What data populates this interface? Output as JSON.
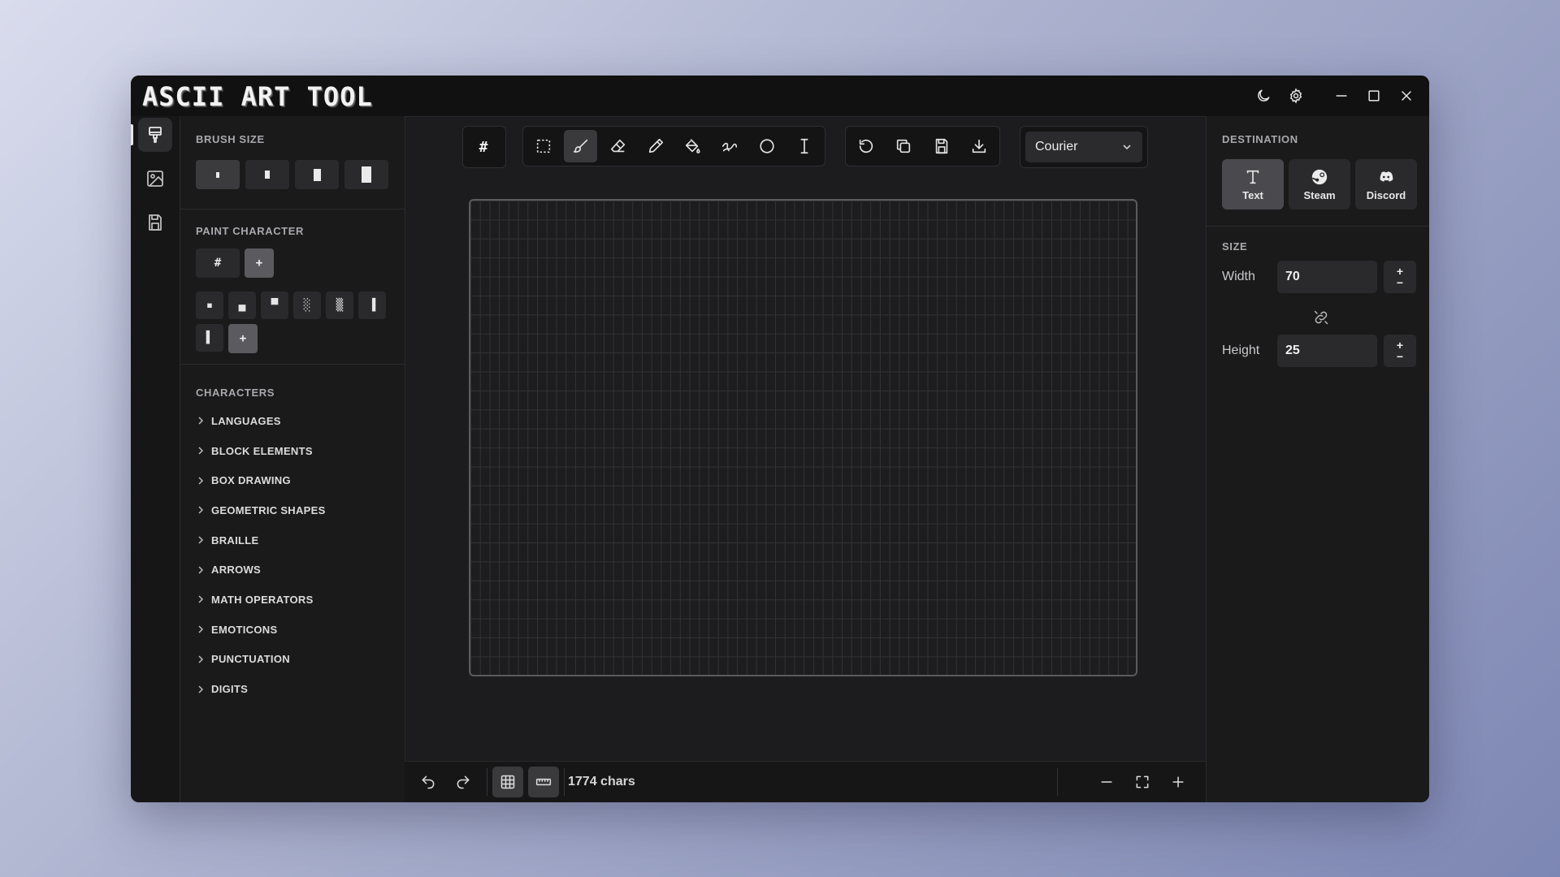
{
  "app": {
    "title": "ASCII ART TOOL"
  },
  "title_actions": [
    "moon-icon",
    "gear-icon",
    "minimize-icon",
    "maximize-icon",
    "close-icon"
  ],
  "rail": {
    "items": [
      "brush-icon",
      "image-icon",
      "save-icon"
    ],
    "active": 0
  },
  "left_panel": {
    "brush_size": {
      "title": "BRUSH SIZE",
      "options": [
        "1",
        "2",
        "3",
        "4"
      ],
      "active": 0
    },
    "paint_character": {
      "title": "PAINT CHARACTER",
      "current": "#",
      "add_label": "+",
      "chars": [
        "▪",
        "▄",
        "▀",
        "░",
        "▒",
        "▐",
        "▌"
      ],
      "chars_add_label": "+"
    },
    "characters": {
      "title": "CHARACTERS",
      "categories": [
        "LANGUAGES",
        "BLOCK ELEMENTS",
        "BOX DRAWING",
        "GEOMETRIC SHAPES",
        "BRAILLE",
        "ARROWS",
        "MATH OPERATORS",
        "EMOTICONS",
        "PUNCTUATION",
        "DIGITS"
      ]
    }
  },
  "toolbar": {
    "current_char": "#",
    "tools": [
      "select-icon",
      "brush-icon",
      "eraser-icon",
      "eyedropper-icon",
      "fill-icon",
      "line-icon",
      "circle-icon",
      "text-cursor-icon"
    ],
    "active_tool": "brush-icon",
    "actions": [
      "rotate-icon",
      "copy-icon",
      "save-icon",
      "download-icon"
    ],
    "font": "Courier"
  },
  "canvas": {
    "columns": 70,
    "rows": 25
  },
  "bottom_bar": {
    "chars_count": "1774 chars",
    "zoom_actions": [
      "zoom-out-icon",
      "fit-screen-icon",
      "zoom-in-icon"
    ]
  },
  "right_panel": {
    "destination": {
      "title": "DESTINATION",
      "options": [
        {
          "label": "Text",
          "icon": "text-icon"
        },
        {
          "label": "Steam",
          "icon": "steam-icon"
        },
        {
          "label": "Discord",
          "icon": "discord-icon"
        }
      ],
      "active": 0
    },
    "size": {
      "title": "SIZE",
      "width_label": "Width",
      "width_value": "70",
      "height_label": "Height",
      "height_value": "25",
      "plus": "+",
      "minus": "−"
    }
  },
  "colors": {
    "window_bg": "#1c1c1e",
    "accent": "#3a3a3d",
    "text": "#e8e8e8"
  }
}
